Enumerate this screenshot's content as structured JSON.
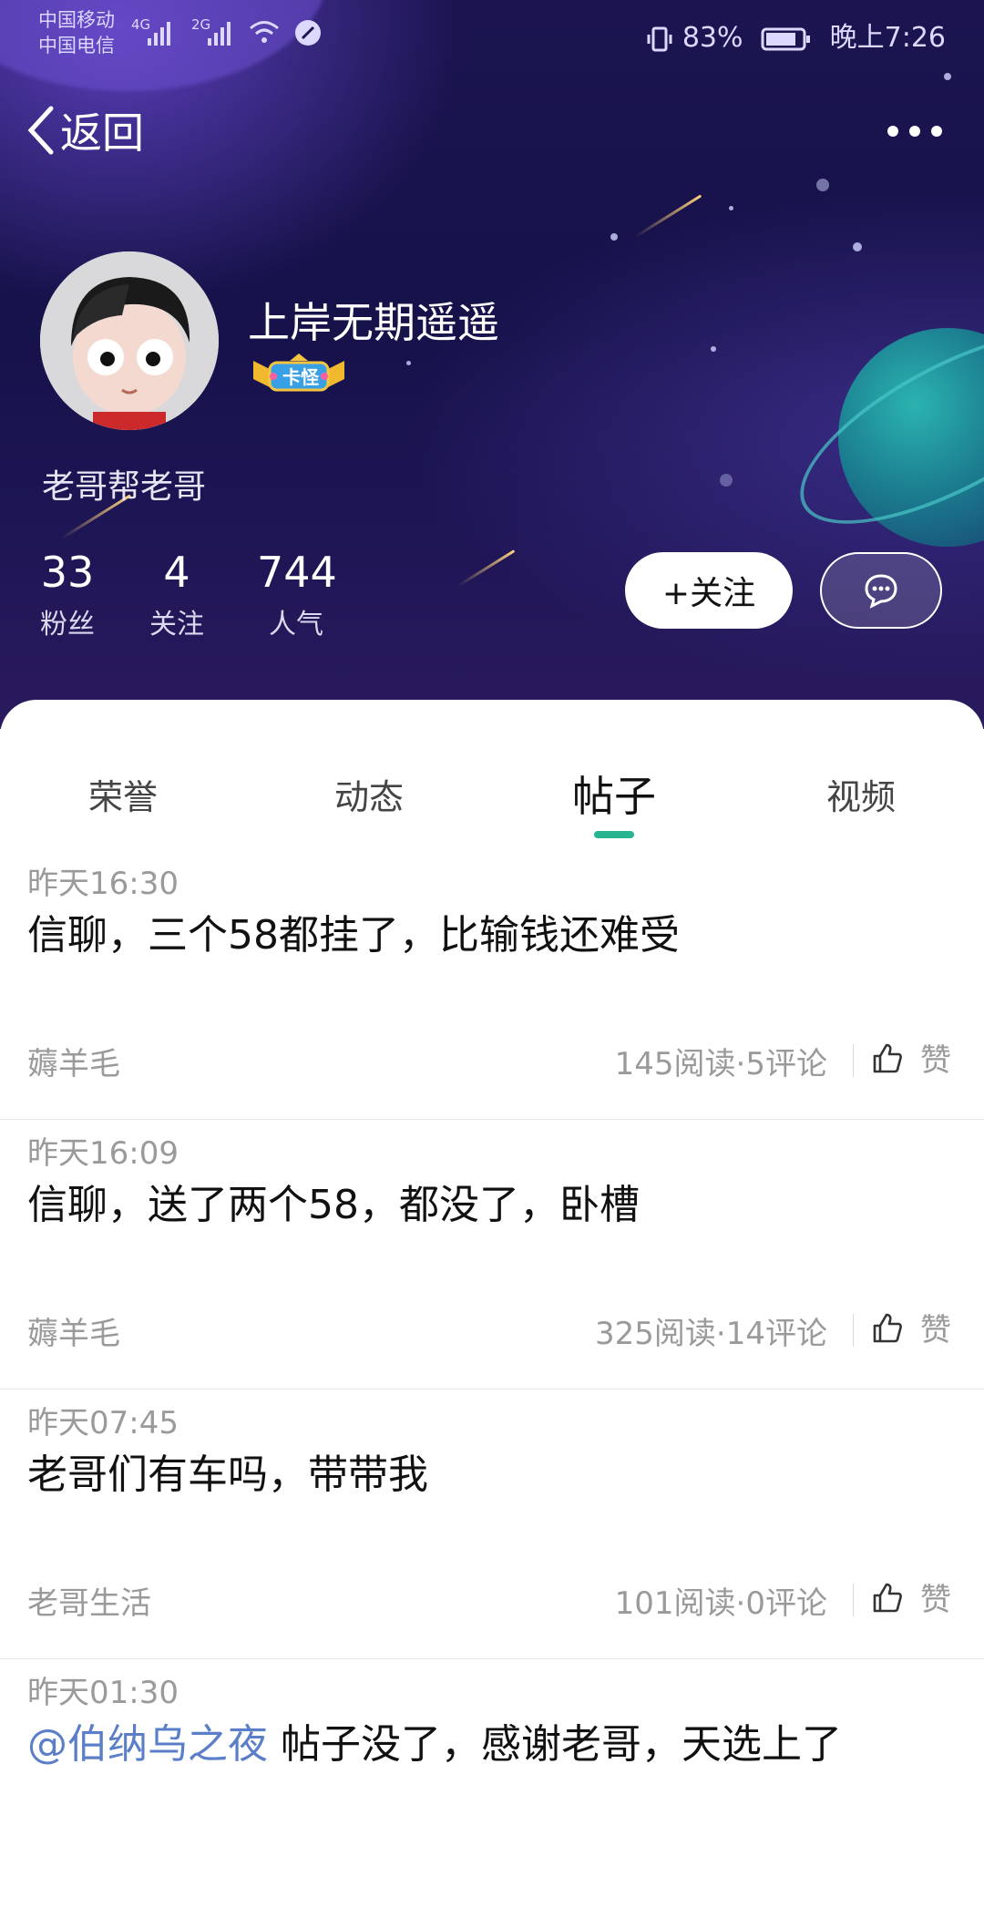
{
  "status": {
    "carrier1": "中国移动",
    "carrier2": "中国电信",
    "net1": "4G",
    "net2": "2G",
    "battery": "83%",
    "time": "晚上7:26"
  },
  "nav": {
    "back_label": "返回"
  },
  "profile": {
    "username": "上岸无期遥遥",
    "badge_text": "卡怪",
    "slogan": "老哥帮老哥"
  },
  "stats": [
    {
      "value": "33",
      "label": "粉丝"
    },
    {
      "value": "4",
      "label": "关注"
    },
    {
      "value": "744",
      "label": "人气"
    }
  ],
  "actions": {
    "follow_label": "+关注"
  },
  "tabs": [
    {
      "label": "荣誉"
    },
    {
      "label": "动态"
    },
    {
      "label": "帖子"
    },
    {
      "label": "视频"
    }
  ],
  "active_tab": "帖子",
  "posts": [
    {
      "time": "昨天16:30",
      "title": "信聊，三个58都挂了，比输钱还难受",
      "category": "薅羊毛",
      "meta": "145阅读·5评论",
      "like": "赞"
    },
    {
      "time": "昨天16:09",
      "title": "信聊，送了两个58，都没了，卧槽",
      "category": "薅羊毛",
      "meta": "325阅读·14评论",
      "like": "赞"
    },
    {
      "time": "昨天07:45",
      "title": "老哥们有车吗，带带我",
      "category": "老哥生活",
      "meta": "101阅读·0评论",
      "like": "赞"
    },
    {
      "time": "昨天01:30",
      "mention": "@伯纳乌之夜",
      "title": " 帖子没了，感谢老哥，天选上了",
      "category": "",
      "meta": "",
      "like": ""
    }
  ],
  "colors": {
    "accent": "#27b591",
    "mention": "#5a7fc8"
  }
}
